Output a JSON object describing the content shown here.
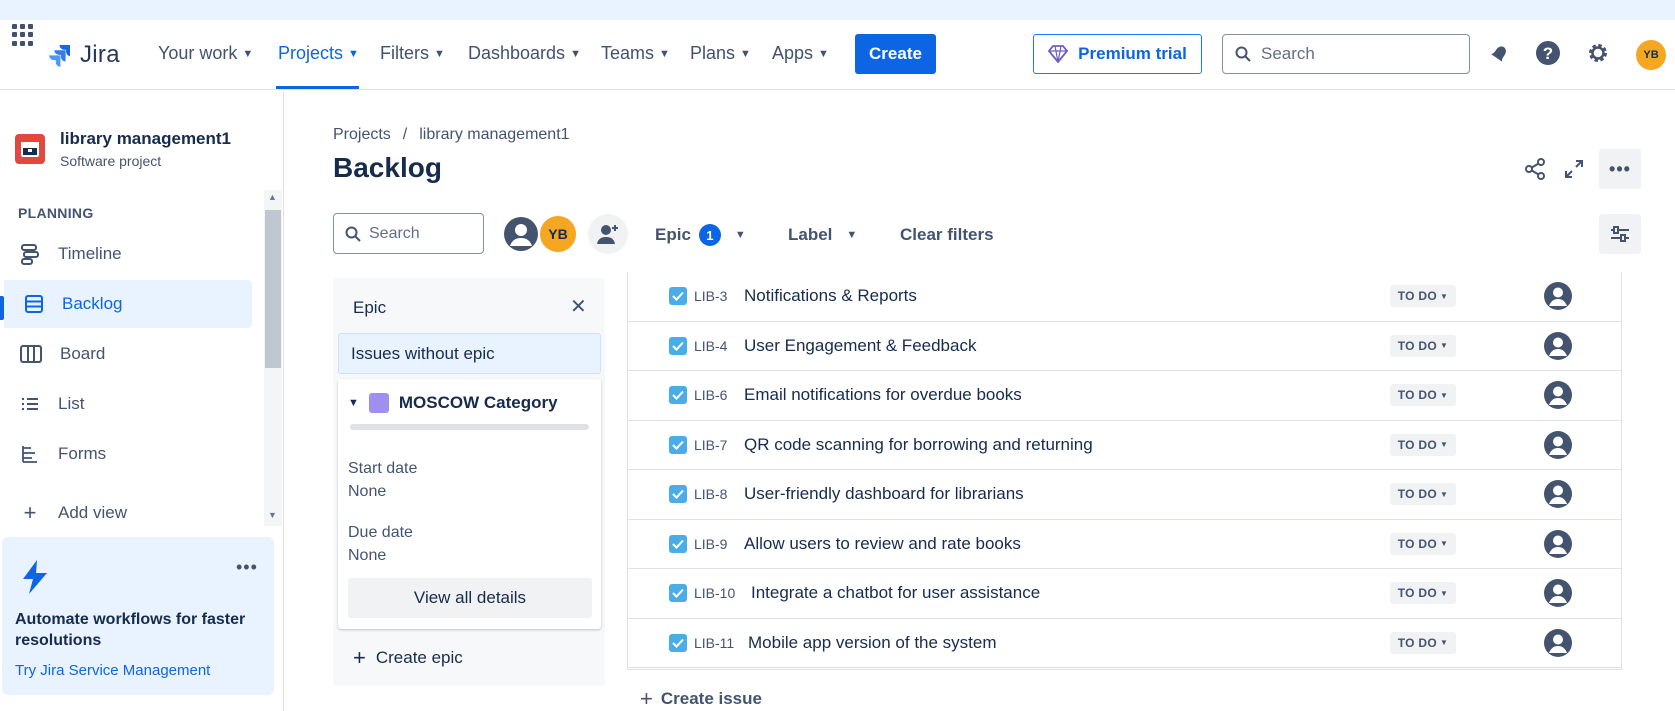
{
  "topbar": {
    "logo_text": "Jira",
    "nav": [
      {
        "label": "Your work"
      },
      {
        "label": "Projects"
      },
      {
        "label": "Filters"
      },
      {
        "label": "Dashboards"
      },
      {
        "label": "Teams"
      },
      {
        "label": "Plans"
      },
      {
        "label": "Apps"
      }
    ],
    "create_label": "Create",
    "premium_label": "Premium trial",
    "search_placeholder": "Search",
    "user_initials": "YB"
  },
  "sidebar": {
    "project_name": "library management1",
    "project_type": "Software project",
    "section_label": "PLANNING",
    "items": [
      {
        "label": "Timeline",
        "icon": "timeline-icon"
      },
      {
        "label": "Backlog",
        "icon": "backlog-icon",
        "active": true
      },
      {
        "label": "Board",
        "icon": "board-icon"
      },
      {
        "label": "List",
        "icon": "list-icon"
      },
      {
        "label": "Forms",
        "icon": "forms-icon"
      },
      {
        "label": "Add view",
        "icon": "plus-icon"
      }
    ],
    "promo": {
      "title": "Automate workflows for faster resolutions",
      "link": "Try Jira Service Management"
    }
  },
  "main": {
    "breadcrumb": [
      "Projects",
      "/",
      "library management1"
    ],
    "title": "Backlog",
    "filters": {
      "search_placeholder": "Search",
      "avatar_initials": "YB",
      "epic_label": "Epic",
      "epic_count": "1",
      "label_label": "Label",
      "clear_label": "Clear filters"
    },
    "epic_panel": {
      "title": "Epic",
      "issues_without_epic": "Issues without epic",
      "epic_name": "MOSCOW Category",
      "start_date_label": "Start date",
      "start_date_value": "None",
      "due_date_label": "Due date",
      "due_date_value": "None",
      "view_all": "View all details",
      "create_epic": "Create epic"
    },
    "issues": [
      {
        "key": "LIB-3",
        "summary": "Notifications & Reports",
        "status": "TO DO"
      },
      {
        "key": "LIB-4",
        "summary": "User Engagement & Feedback",
        "status": "TO DO"
      },
      {
        "key": "LIB-6",
        "summary": "Email notifications for overdue books",
        "status": "TO DO"
      },
      {
        "key": "LIB-7",
        "summary": "QR code scanning for borrowing and returning",
        "status": "TO DO"
      },
      {
        "key": "LIB-8",
        "summary": "User-friendly dashboard for librarians",
        "status": "TO DO"
      },
      {
        "key": "LIB-9",
        "summary": "Allow users to review and rate books",
        "status": "TO DO"
      },
      {
        "key": "LIB-10",
        "summary": "Integrate a chatbot for user assistance",
        "status": "TO DO"
      },
      {
        "key": "LIB-11",
        "summary": "Mobile app version of the system",
        "status": "TO DO"
      }
    ],
    "create_issue": "Create issue"
  },
  "colors": {
    "accent": "#0c66e4",
    "project_icon": "#e2483d",
    "epic_color": "#9f8fef",
    "avatar": "#f5a623",
    "checkbox": "#4bade8"
  }
}
